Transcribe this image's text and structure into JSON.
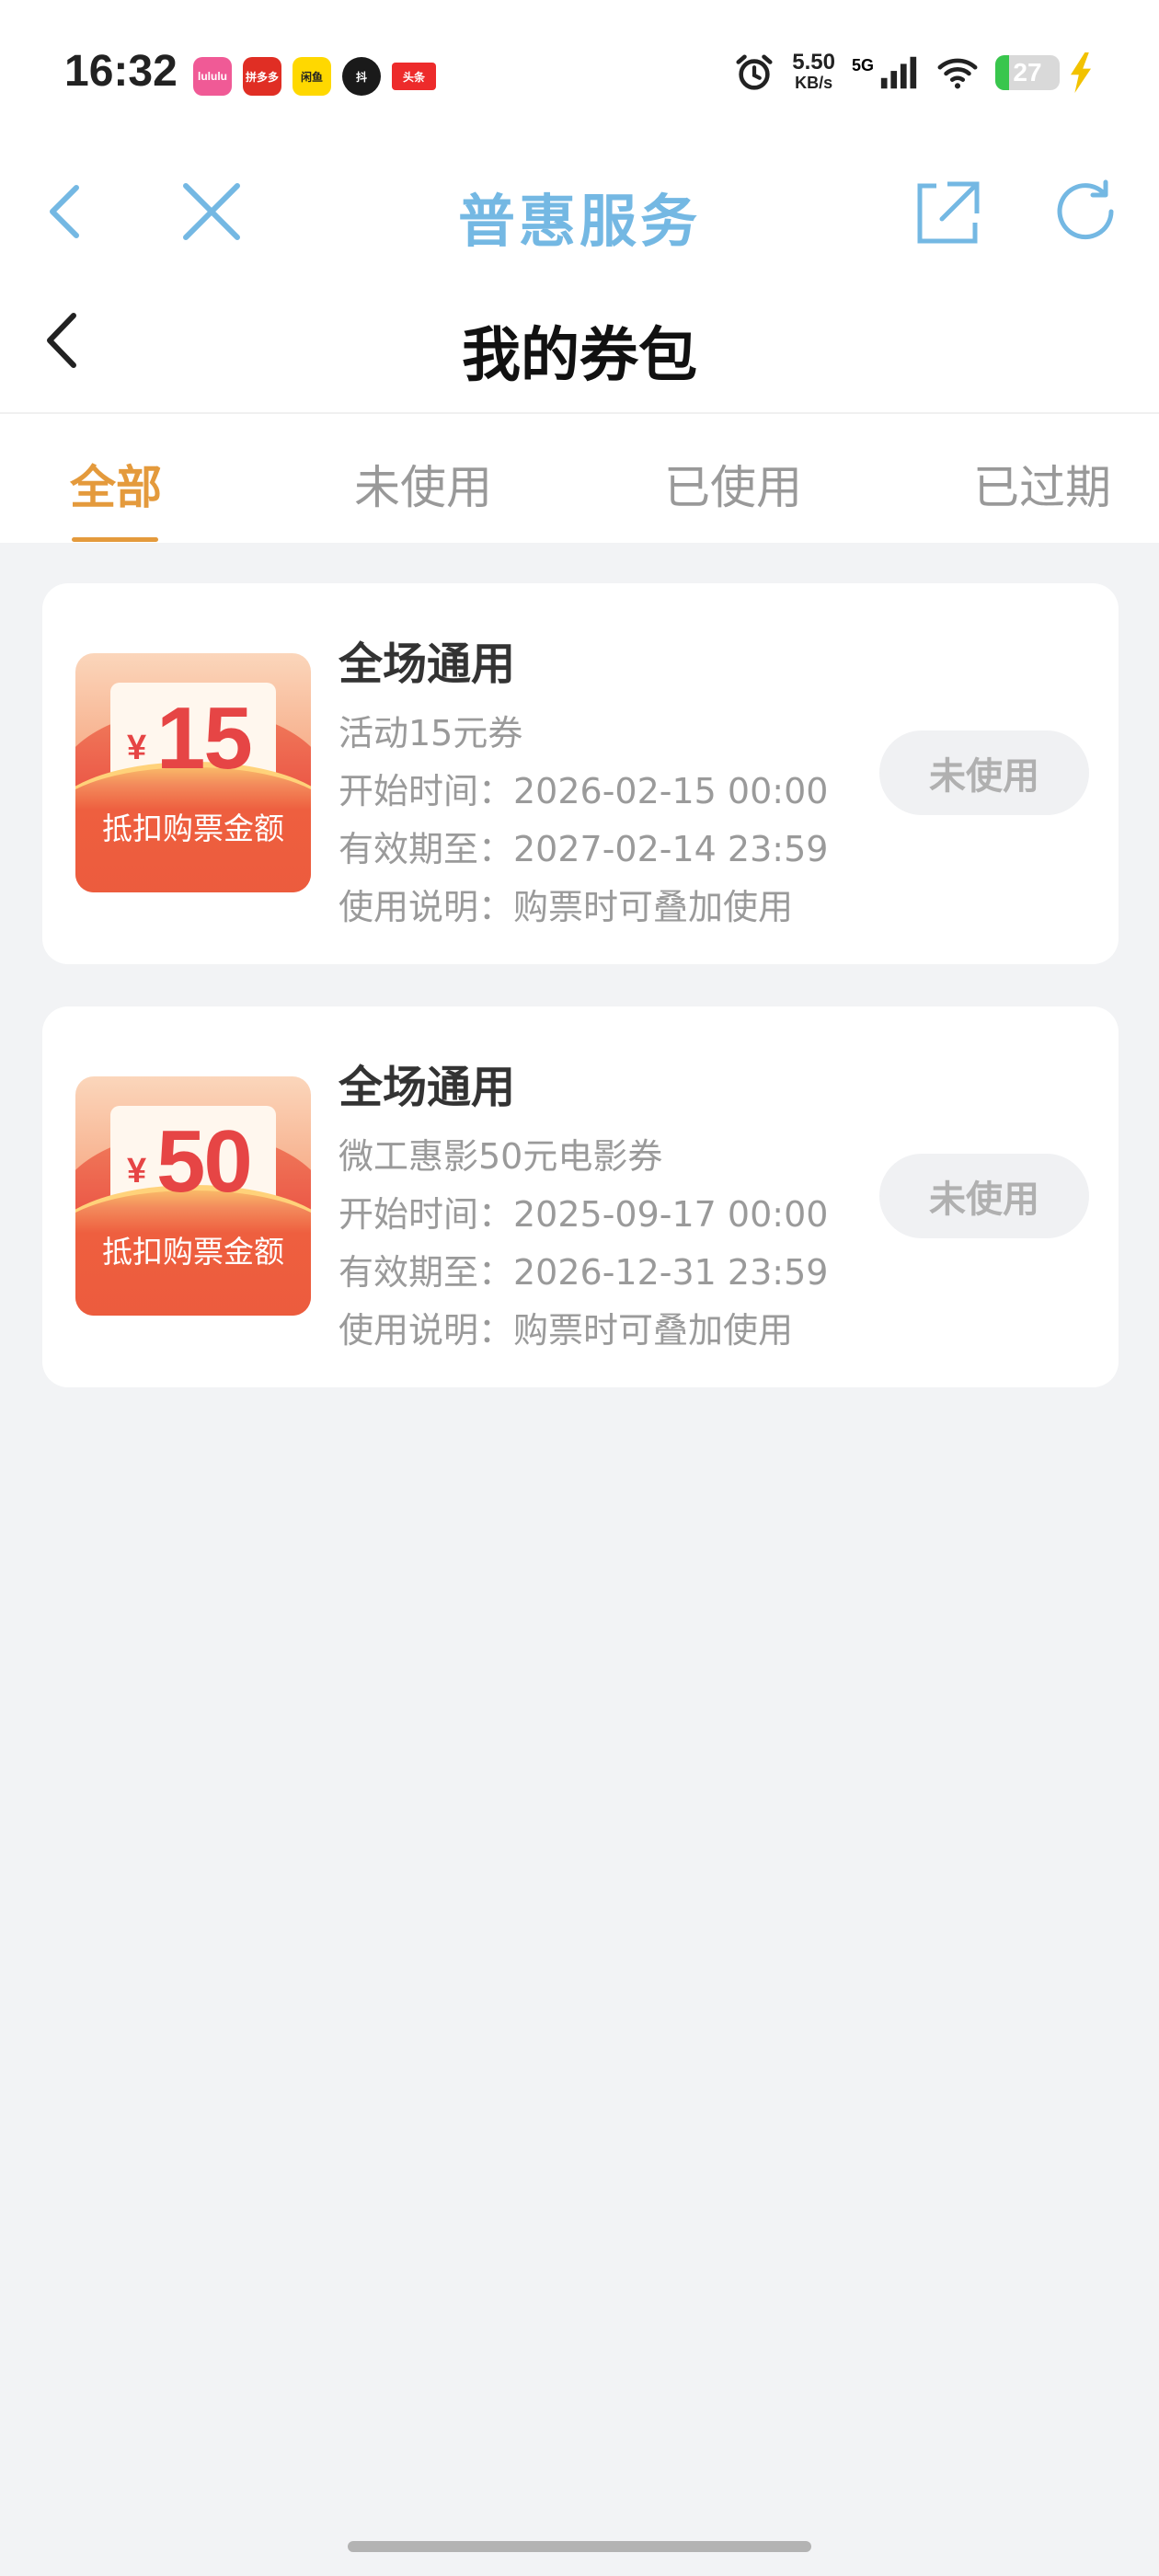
{
  "status_bar": {
    "time": "16:32",
    "net_speed": "5.50",
    "net_unit": "KB/s",
    "network": "5G",
    "battery": "27",
    "app_icons": [
      {
        "name": "app-icon-1",
        "label": "lululu",
        "color": "#f05a96"
      },
      {
        "name": "app-icon-2",
        "label": "拼多多",
        "color": "#e02e24"
      },
      {
        "name": "app-icon-3",
        "label": "闲鱼",
        "color": "#ffd800"
      },
      {
        "name": "app-icon-4",
        "label": "抖",
        "color": "#1a1a1a"
      },
      {
        "name": "app-icon-5",
        "label": "头条",
        "color": "#ed2b2b"
      }
    ]
  },
  "nav": {
    "title": "普惠服务"
  },
  "header": {
    "title": "我的券包"
  },
  "tabs": [
    {
      "label": "全部",
      "active": true
    },
    {
      "label": "未使用",
      "active": false
    },
    {
      "label": "已使用",
      "active": false
    },
    {
      "label": "已过期",
      "active": false
    }
  ],
  "coupons": [
    {
      "yen": "¥",
      "amount": "15",
      "caption": "抵扣购票金额",
      "title": "全场通用",
      "subtitle": "活动15元券",
      "start": "开始时间：2026-02-15 00:00",
      "expire": "有效期至：2027-02-14 23:59",
      "note": "使用说明：购票时可叠加使用",
      "status": "未使用"
    },
    {
      "yen": "¥",
      "amount": "50",
      "caption": "抵扣购票金额",
      "title": "全场通用",
      "subtitle": "微工惠影50元电影券",
      "start": "开始时间：2025-09-17 00:00",
      "expire": "有效期至：2026-12-31 23:59",
      "note": "使用说明：购票时可叠加使用",
      "status": "未使用"
    }
  ],
  "colors": {
    "accent": "#e49a3c",
    "nav_blue": "#74b8e3",
    "coupon_red": "#e64545"
  }
}
